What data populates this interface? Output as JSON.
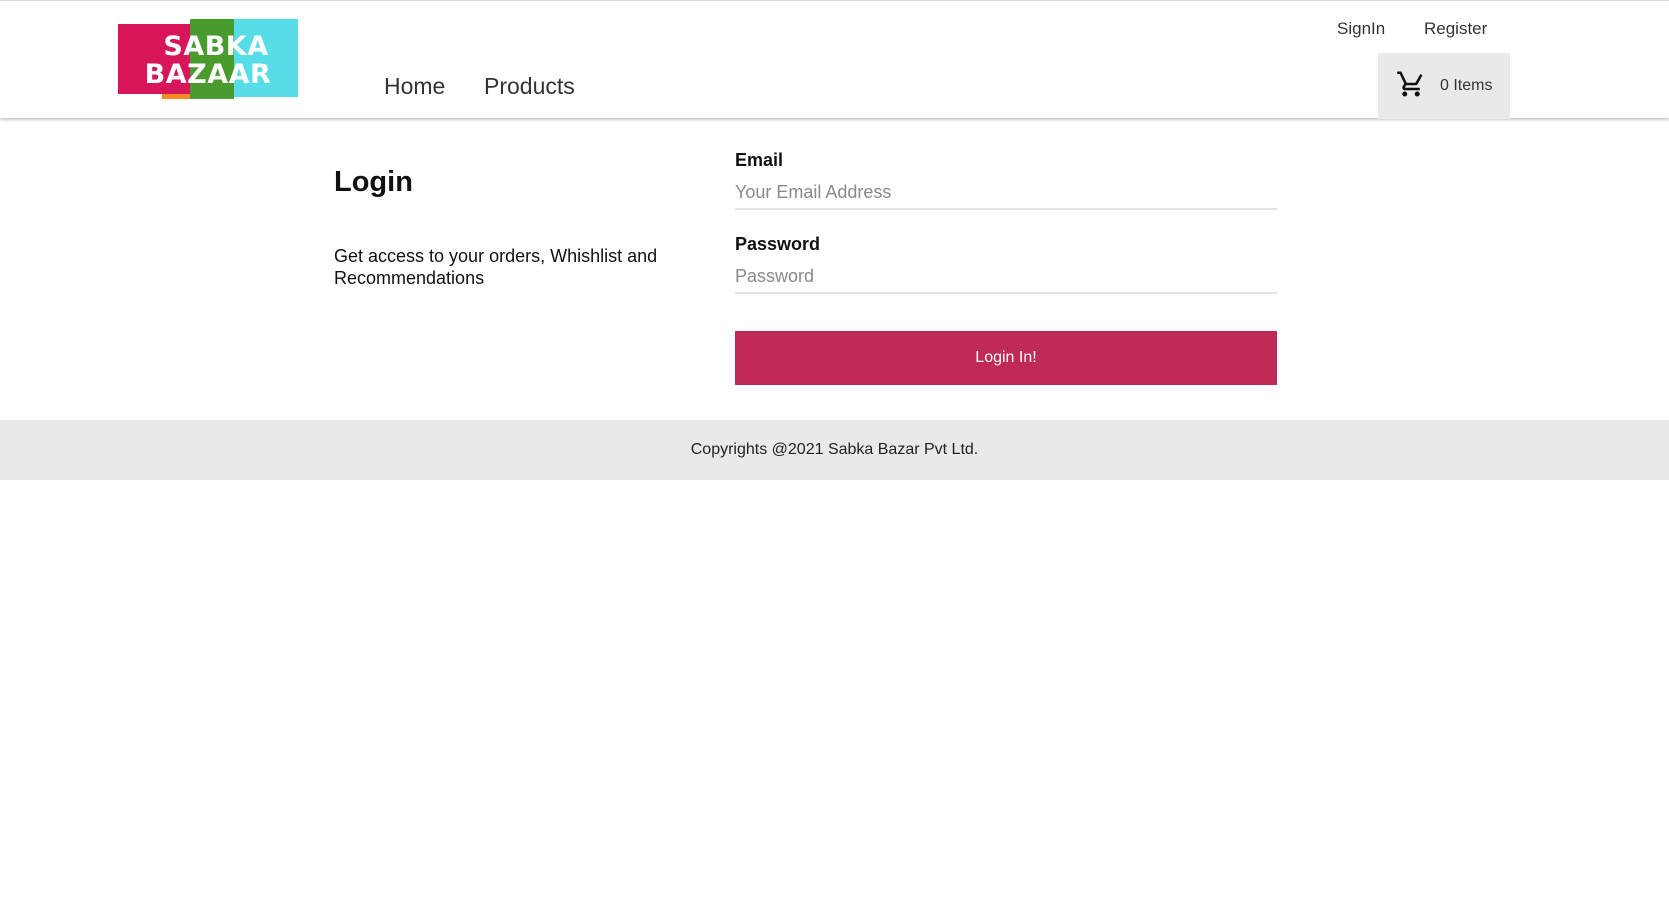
{
  "brand": {
    "logo_line1": "SABKA",
    "logo_line2": "BAZAAR",
    "colors": {
      "red": "#d8155a",
      "cyan": "#56dde7",
      "orange": "#f58a1f",
      "green": "#4a9b2e"
    }
  },
  "nav": {
    "home": "Home",
    "products": "Products"
  },
  "account": {
    "signin": "SignIn",
    "register": "Register"
  },
  "cart": {
    "icon": "shopping-cart-icon",
    "count_label": "0 Items"
  },
  "login": {
    "title": "Login",
    "description": "Get access to your orders, Whishlist and Recommendations",
    "email_label": "Email",
    "email_placeholder": "Your Email Address",
    "email_value": "",
    "password_label": "Password",
    "password_placeholder": "Password",
    "password_value": "",
    "submit_label": "Login In!",
    "accent_color": "#c02a56"
  },
  "footer": {
    "copyright": "Copyrights @2021 Sabka Bazar Pvt Ltd."
  }
}
